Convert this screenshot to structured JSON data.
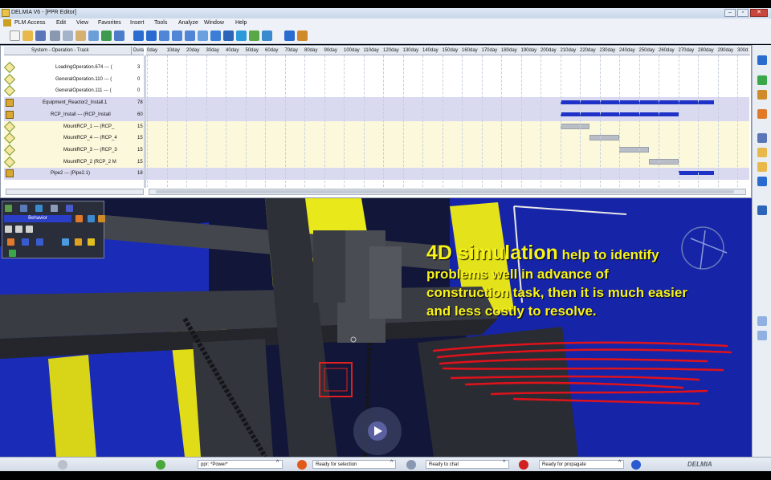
{
  "window": {
    "title": "DELMIA V6 - [PPR Editor]",
    "controls": [
      "minimize",
      "restore",
      "close"
    ]
  },
  "menubar": {
    "items": [
      "PLM Access",
      "Edit",
      "View",
      "Favorites",
      "Insert",
      "Tools",
      "Analyze",
      "Window",
      "Help"
    ]
  },
  "toolbar": {
    "icons": [
      "new-icon",
      "open-icon",
      "save-icon",
      "cut-icon",
      "copy-icon",
      "paste-icon",
      "undo-icon",
      "redo-icon",
      "refresh-icon",
      "help-icon",
      "pan-icon",
      "move-icon",
      "rotate-icon",
      "zoom-in-icon",
      "zoom-out-icon",
      "normal-view-icon",
      "fit-all-icon",
      "cube-icon",
      "iso-view-icon",
      "render-icon",
      "show-icon",
      "network-icon",
      "toolbox-icon"
    ]
  },
  "gantt": {
    "tree_header": "System - Operation - Track",
    "duration_header": "Dura",
    "scale": [
      "0day",
      "10day",
      "20day",
      "30day",
      "40day",
      "50day",
      "60day",
      "70day",
      "80day",
      "90day",
      "100day",
      "110day",
      "120day",
      "130day",
      "140day",
      "150day",
      "160day",
      "170day",
      "180day",
      "190day",
      "200day",
      "210day",
      "220day",
      "230day",
      "240day",
      "250day",
      "260day",
      "270day",
      "280day",
      "290day",
      "300d"
    ],
    "rows": [
      {
        "label": "LoadingOperation.674 --- (",
        "duration": "3",
        "type": "op",
        "indent": 68,
        "band": "white"
      },
      {
        "label": "GeneralOperation.110 --- (",
        "duration": "0",
        "type": "op",
        "indent": 68,
        "band": "white"
      },
      {
        "label": "GeneralOperation.111 --- (",
        "duration": "0",
        "type": "op",
        "indent": 68,
        "band": "white"
      },
      {
        "label": "Equipment_Reactor2_Install.1",
        "duration": "78",
        "type": "res",
        "indent": 52,
        "band": "lav"
      },
      {
        "label": "RCP_Install --- (RCP_Install",
        "duration": "60",
        "type": "res",
        "indent": 62,
        "band": "lav"
      },
      {
        "label": "MountRCP_1 --- (RCP_",
        "duration": "15",
        "type": "op",
        "indent": 78,
        "band": "yellow"
      },
      {
        "label": "MountRCP_4 --- (RCP_4",
        "duration": "15",
        "type": "op",
        "indent": 78,
        "band": "yellow"
      },
      {
        "label": "MountRCP_3 --- (RCP_3",
        "duration": "15",
        "type": "op",
        "indent": 78,
        "band": "yellow"
      },
      {
        "label": "MountRCP_2 (RCP_2 M",
        "duration": "15",
        "type": "op",
        "indent": 78,
        "band": "yellow"
      },
      {
        "label": "Pipe2 --- (Pipe2.1)",
        "duration": "18",
        "type": "res",
        "indent": 62,
        "band": "lav"
      }
    ],
    "bars": [
      {
        "row": 3,
        "kind": "summary",
        "start": 210,
        "duration": 78
      },
      {
        "row": 4,
        "kind": "summary",
        "start": 210,
        "duration": 60
      },
      {
        "row": 5,
        "kind": "task",
        "start": 210,
        "duration": 15
      },
      {
        "row": 6,
        "kind": "task",
        "start": 225,
        "duration": 15
      },
      {
        "row": 7,
        "kind": "task",
        "start": 240,
        "duration": 15
      },
      {
        "row": 8,
        "kind": "task",
        "start": 255,
        "duration": 15
      },
      {
        "row": 9,
        "kind": "summary",
        "start": 270,
        "duration": 18
      }
    ]
  },
  "behavior_panel": {
    "title": "Behavior"
  },
  "caption": {
    "highlight": "4D simulation",
    "line1_rest": " help  to identify",
    "line2": "problems well in advance of",
    "line3": "construction task, then it is  much easier",
    "line4": "and less costly to resolve."
  },
  "statusbar": {
    "fields": [
      {
        "value": "ppr: *Power*"
      },
      {
        "value": "Ready for selection"
      },
      {
        "value": "Ready to chat"
      },
      {
        "value": "Ready for propagate"
      }
    ],
    "brand": "DELMIA"
  },
  "colors": {
    "caption": "#f7f21a",
    "summary_bar": "#1e32c8",
    "task_bar": "#b9bec6",
    "scribble": "#e0121a"
  }
}
